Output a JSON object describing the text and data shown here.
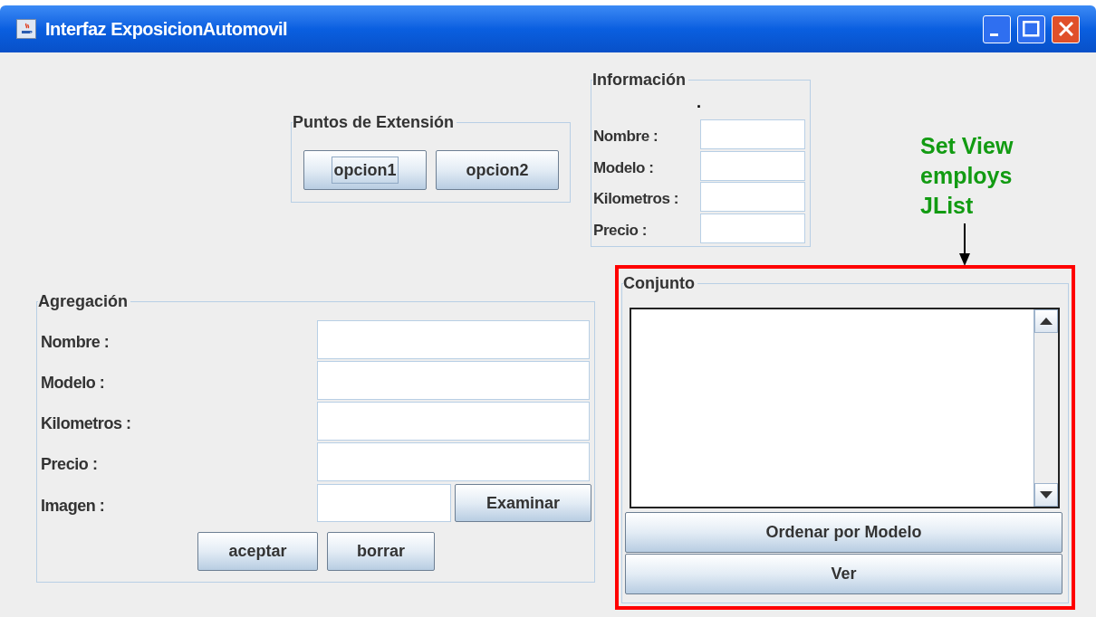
{
  "window": {
    "title": "Interfaz ExposicionAutomovil"
  },
  "extension_points": {
    "title": "Puntos de Extensión",
    "buttons": [
      {
        "label": "opcion1",
        "focused": true
      },
      {
        "label": "opcion2",
        "focused": false
      }
    ]
  },
  "information": {
    "title": "Información",
    "marker": ".",
    "fields": [
      {
        "label": "Nombre :"
      },
      {
        "label": "Modelo :"
      },
      {
        "label": "Kilometros :"
      },
      {
        "label": "Precio :"
      }
    ]
  },
  "aggregation": {
    "title": "Agregación",
    "fields": [
      {
        "label": "Nombre :"
      },
      {
        "label": "Modelo :"
      },
      {
        "label": "Kilometros :"
      },
      {
        "label": "Precio :"
      }
    ],
    "image": {
      "label": "Imagen :",
      "button": "Examinar"
    },
    "buttons": [
      "aceptar",
      "borrar"
    ]
  },
  "annotation": {
    "lines": [
      "Set View",
      "employs",
      "JList"
    ]
  },
  "set": {
    "title": "Conjunto",
    "buttons": [
      "Ordenar por Modelo",
      "Ver"
    ]
  }
}
